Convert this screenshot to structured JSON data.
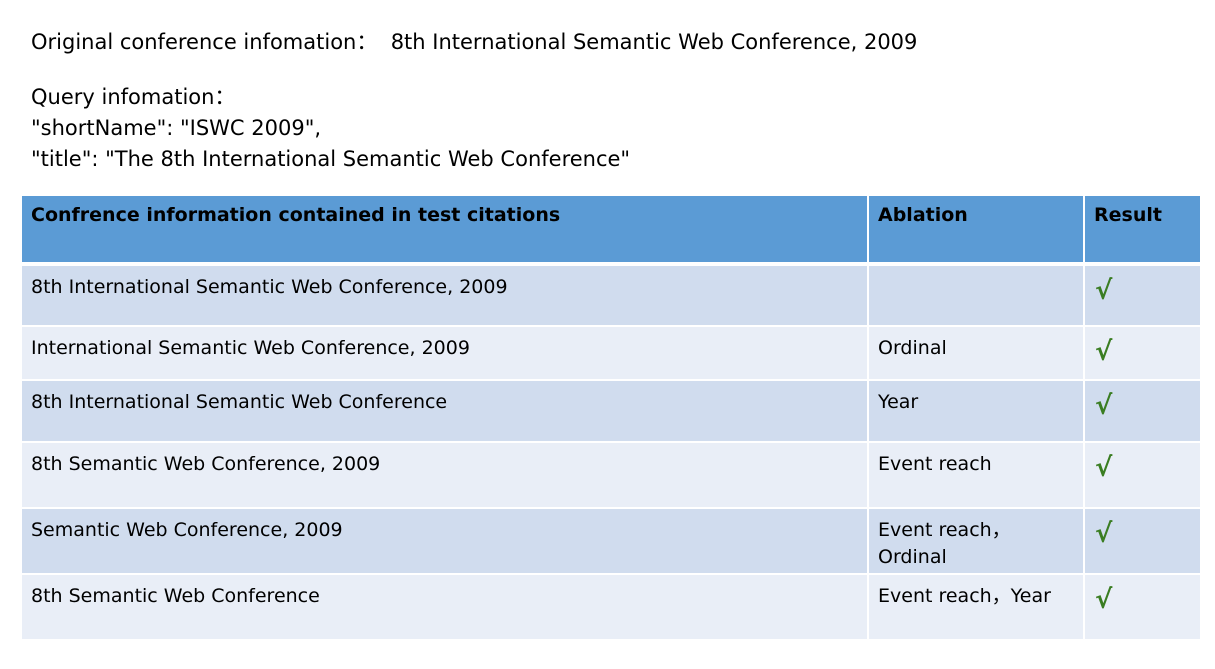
{
  "intro": {
    "original_line": "Original conference infomation：  8th International Semantic Web Conference, 2009",
    "query_heading": "Query infomation：",
    "query_short_name": "\"shortName\": \"ISWC 2009\",",
    "query_title": "\"title\": \"The 8th International Semantic Web Conference\""
  },
  "table": {
    "headers": [
      "Confrence information contained in test citations",
      "Ablation",
      "Result"
    ],
    "rows": [
      {
        "citation": "8th International Semantic Web Conference, 2009",
        "ablation": "",
        "result": "√"
      },
      {
        "citation": "International Semantic Web Conference, 2009",
        "ablation": "Ordinal",
        "result": "√"
      },
      {
        "citation": "8th International Semantic Web Conference",
        "ablation": "Year",
        "result": "√"
      },
      {
        "citation": "8th Semantic Web Conference, 2009",
        "ablation": "Event reach",
        "result": "√"
      },
      {
        "citation": "Semantic Web Conference, 2009",
        "ablation": "Event reach，Ordinal",
        "result": "√"
      },
      {
        "citation": "8th Semantic Web Conference",
        "ablation": "Event reach，Year",
        "result": "√"
      }
    ],
    "colors": {
      "header_bg": "#5b9bd5",
      "row_odd_bg": "#d0dcee",
      "row_even_bg": "#e9eef7",
      "check_color": "#3a7d22"
    }
  }
}
